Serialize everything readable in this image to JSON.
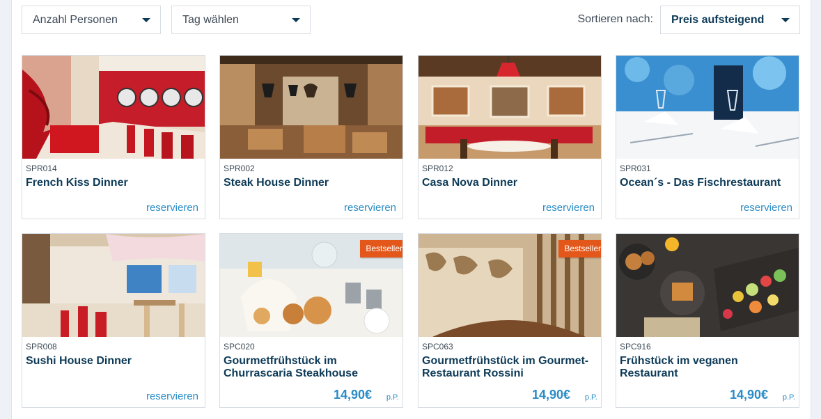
{
  "filters": {
    "persons_label": "Anzahl Personen",
    "day_label": "Tag wählen",
    "sort_prefix": "Sortieren nach:",
    "sort_value": "Preis aufsteigend",
    "caret_icon": "chevron-down-icon"
  },
  "colors": {
    "brand_navy": "#0d3a57",
    "link_blue": "#2a8cc6",
    "badge_orange": "#e4571b",
    "border": "#d7dde3"
  },
  "cards": [
    {
      "code": "SPR014",
      "title": "French Kiss Dinner",
      "action": "reservieren"
    },
    {
      "code": "SPR002",
      "title": "Steak House Dinner",
      "action": "reservieren"
    },
    {
      "code": "SPR012",
      "title": "Casa Nova Dinner",
      "action": "reservieren"
    },
    {
      "code": "SPR031",
      "title": "Ocean´s - Das Fischrestaurant",
      "action": "reservieren"
    },
    {
      "code": "SPR008",
      "title": "Sushi House Dinner",
      "action": "reservieren"
    },
    {
      "code": "SPC020",
      "title": "Gourmetfrühstück im Churrascaria Steakhouse",
      "badge": "Bestseller",
      "price": "14,90€",
      "price_unit": "p.P."
    },
    {
      "code": "SPC063",
      "title": "Gourmetfrühstück im Gourmet-Restaurant Rossini",
      "badge": "Bestseller",
      "price": "14,90€",
      "price_unit": "p.P."
    },
    {
      "code": "SPC916",
      "title": "Frühstück im veganen Restaurant",
      "price": "14,90€",
      "price_unit": "p.P."
    }
  ]
}
